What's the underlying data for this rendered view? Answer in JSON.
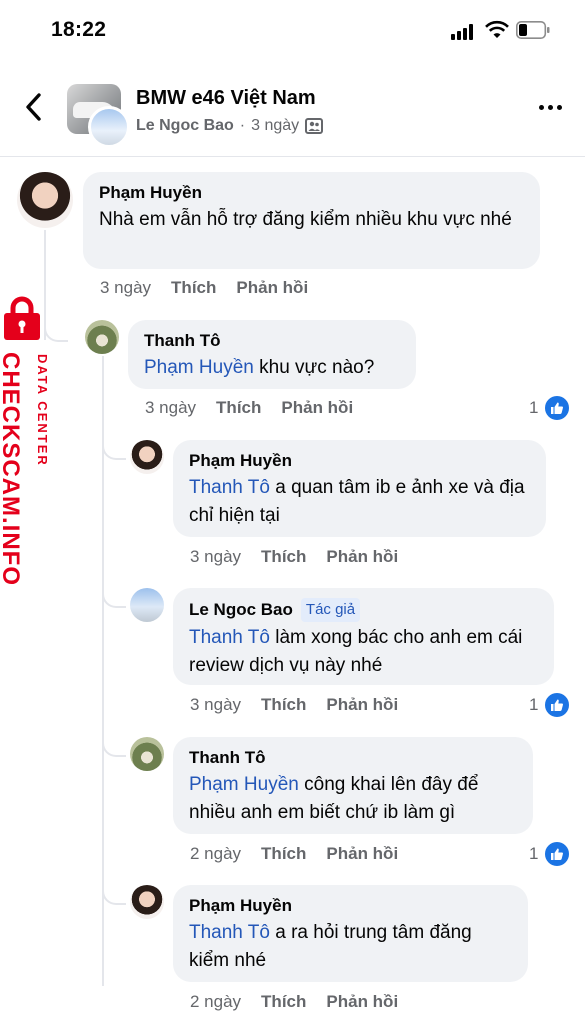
{
  "status_bar": {
    "time": "18:22"
  },
  "header": {
    "group_name": "BMW e46 Việt Nam",
    "author": "Le Ngoc Bao",
    "separator": "·",
    "time_ago": "3 ngày",
    "privacy_icon": "group-members-icon"
  },
  "watermark": {
    "brand": "CHECKSCAM.INFO",
    "tag": "DATA CENTER",
    "color": "#e4001b"
  },
  "comments": [
    {
      "name": "Phạm Huyền",
      "mention": "",
      "text": "Nhà em vẫn hỗ trợ đăng kiểm nhiều khu vực nhé",
      "time": "3 ngày",
      "like": "Thích",
      "reply": "Phản hồi",
      "reactions": ""
    },
    {
      "name": "Thanh Tô",
      "mention": "Phạm Huyền",
      "text": " khu vực nào?",
      "time": "3 ngày",
      "like": "Thích",
      "reply": "Phản hồi",
      "reactions": "1"
    },
    {
      "name": "Phạm Huyền",
      "mention": "Thanh Tô",
      "text": " a quan tâm ib e ảnh xe và địa chỉ hiện tại",
      "time": "3 ngày",
      "like": "Thích",
      "reply": "Phản hồi",
      "reactions": ""
    },
    {
      "name": "Le Ngoc Bao",
      "badge": "Tác giả",
      "mention": "Thanh Tô",
      "text": "  làm xong bác cho anh em cái review dịch vụ này nhé",
      "time": "3 ngày",
      "like": "Thích",
      "reply": "Phản hồi",
      "reactions": "1"
    },
    {
      "name": "Thanh Tô",
      "mention": "Phạm Huyền",
      "text": " công khai lên đây để nhiều anh em biết chứ ib làm gì",
      "time": "2 ngày",
      "like": "Thích",
      "reply": "Phản hồi",
      "reactions": "1"
    },
    {
      "name": "Phạm Huyền",
      "mention": "Thanh Tô",
      "text": " a ra hỏi trung tâm đăng kiểm nhé",
      "time": "2 ngày",
      "like": "Thích",
      "reply": "Phản hồi",
      "reactions": ""
    }
  ]
}
